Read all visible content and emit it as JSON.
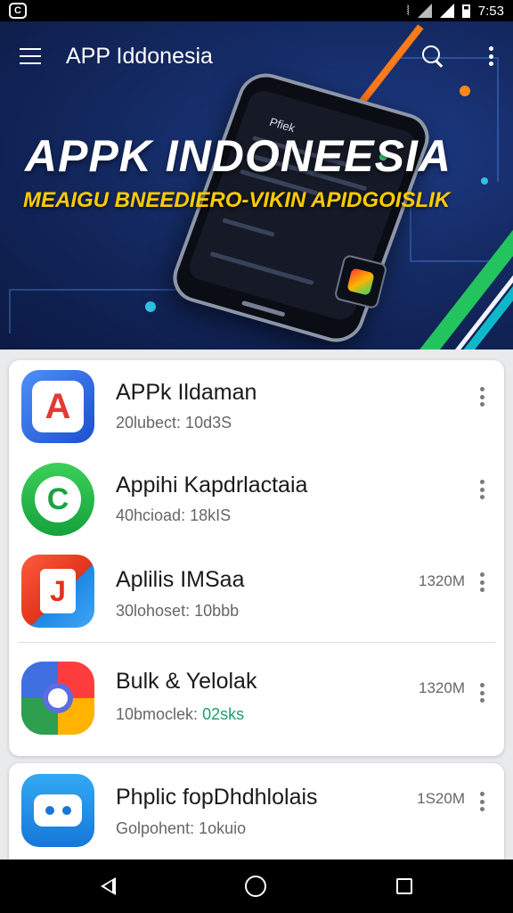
{
  "status_bar": {
    "app_badge": "C",
    "vibrate_icon": "vibrate-icon",
    "time": "7:53"
  },
  "header": {
    "title": "APP Iddonesia",
    "menu_icon": "hamburger-menu-icon",
    "search_icon": "search-icon",
    "overflow_icon": "overflow-menu-icon"
  },
  "banner": {
    "title": "APPK INDONEESIA",
    "subtitle": "MEAIGU BNEEDIERO-VIKIN APIDGOISLIK",
    "phone_text": "Pfiek",
    "colors": {
      "background": "#142a63",
      "subtitle": "#ffcc00",
      "stripe_green": "#23c45e",
      "stripe_orange": "#ff7a1a"
    }
  },
  "apps": [
    {
      "name": "APPk Ildaman",
      "meta": "20lubect: 10d3S",
      "size": "",
      "glyph": "A",
      "icon": "app-a-icon"
    },
    {
      "name": "Appihi Kapdrlactaia",
      "meta": "40hcioad: 18kIS",
      "size": "",
      "glyph": "C",
      "icon": "chat-bubble-icon"
    },
    {
      "name": "Aplilis IMSaa",
      "meta": "30lohoset: 10bbb",
      "size": "1320M",
      "glyph": "J",
      "icon": "app-j-icon"
    },
    {
      "name": "Bulk & Yelolak",
      "meta_prefix": "10bmoclek: ",
      "meta_highlight": "02sks",
      "size": "1320M",
      "icon": "chrome-like-icon"
    },
    {
      "name": "Phplic fopDhdhlolais",
      "meta": "Golpohent: 1okuio",
      "size": "1S20M",
      "icon": "bot-face-icon"
    }
  ],
  "nav": {
    "back_icon": "back-icon",
    "home_icon": "home-icon",
    "recents_icon": "recents-icon"
  }
}
